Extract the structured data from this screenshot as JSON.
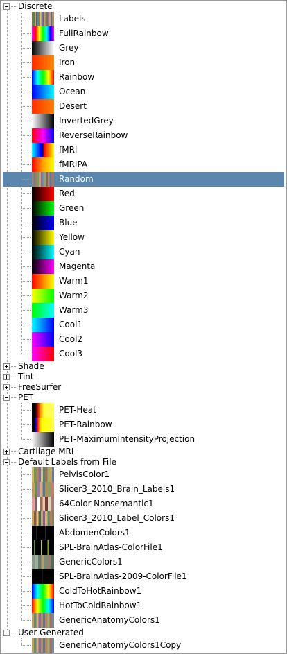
{
  "colors": {
    "selection": "#5b86ae",
    "selected_text": "#ffffff",
    "tree_lines": "#9a9a9a"
  },
  "tree": {
    "groups": [
      {
        "label": "Discrete",
        "expanded": true,
        "items": [
          {
            "label": "Labels",
            "swatch": "labels-swatch"
          },
          {
            "label": "FullRainbow",
            "swatch": "fullrainbow-swatch"
          },
          {
            "label": "Grey",
            "swatch": "grey-swatch"
          },
          {
            "label": "Iron",
            "swatch": "iron-swatch"
          },
          {
            "label": "Rainbow",
            "swatch": "rainbow-swatch"
          },
          {
            "label": "Ocean",
            "swatch": "ocean-swatch"
          },
          {
            "label": "Desert",
            "swatch": "desert-swatch"
          },
          {
            "label": "InvertedGrey",
            "swatch": "invertedgrey-swatch"
          },
          {
            "label": "ReverseRainbow",
            "swatch": "reverserainbow-swatch"
          },
          {
            "label": "fMRI",
            "swatch": "fmri-swatch"
          },
          {
            "label": "fMRIPA",
            "swatch": "fmripa-swatch"
          },
          {
            "label": "Random",
            "swatch": "random-swatch",
            "selected": true
          },
          {
            "label": "Red",
            "swatch": "red-swatch"
          },
          {
            "label": "Green",
            "swatch": "green-swatch"
          },
          {
            "label": "Blue",
            "swatch": "blue-swatch"
          },
          {
            "label": "Yellow",
            "swatch": "yellow-swatch"
          },
          {
            "label": "Cyan",
            "swatch": "cyan-swatch"
          },
          {
            "label": "Magenta",
            "swatch": "magenta-swatch"
          },
          {
            "label": "Warm1",
            "swatch": "warm1-swatch"
          },
          {
            "label": "Warm2",
            "swatch": "warm2-swatch"
          },
          {
            "label": "Warm3",
            "swatch": "warm3-swatch"
          },
          {
            "label": "Cool1",
            "swatch": "cool1-swatch"
          },
          {
            "label": "Cool2",
            "swatch": "cool2-swatch"
          },
          {
            "label": "Cool3",
            "swatch": "cool3-swatch"
          }
        ]
      },
      {
        "label": "Shade",
        "expanded": false,
        "items": []
      },
      {
        "label": "Tint",
        "expanded": false,
        "items": []
      },
      {
        "label": "FreeSurfer",
        "expanded": false,
        "items": []
      },
      {
        "label": "PET",
        "expanded": true,
        "items": [
          {
            "label": "PET-Heat",
            "swatch": "pet-heat-swatch"
          },
          {
            "label": "PET-Rainbow",
            "swatch": "pet-rainbow-swatch"
          },
          {
            "label": "PET-MaximumIntensityProjection",
            "swatch": "pet-mip-swatch"
          }
        ]
      },
      {
        "label": "Cartilage MRI",
        "expanded": false,
        "items": []
      },
      {
        "label": "Default Labels from File",
        "expanded": true,
        "items": [
          {
            "label": "PelvisColor1",
            "swatch": "pelvis-swatch"
          },
          {
            "label": "Slicer3_2010_Brain_Labels1",
            "swatch": "brain-labels-swatch"
          },
          {
            "label": "64Color-Nonsemantic1",
            "swatch": "nonsemantic-swatch"
          },
          {
            "label": "Slicer3_2010_Label_Colors1",
            "swatch": "label-colors-swatch"
          },
          {
            "label": "AbdomenColors1",
            "swatch": "abdomen-swatch"
          },
          {
            "label": "SPL-BrainAtlas-ColorFile1",
            "swatch": "spl-atlas-swatch"
          },
          {
            "label": "GenericColors1",
            "swatch": "generic-swatch"
          },
          {
            "label": "SPL-BrainAtlas-2009-ColorFile1",
            "swatch": "spl-atlas-2009-swatch"
          },
          {
            "label": "ColdToHotRainbow1",
            "swatch": "coldtohot-swatch"
          },
          {
            "label": "HotToColdRainbow1",
            "swatch": "hottocold-swatch"
          },
          {
            "label": "GenericAnatomyColors1",
            "swatch": "genericanatomy-swatch"
          }
        ]
      },
      {
        "label": "User Generated",
        "expanded": true,
        "items": [
          {
            "label": "GenericAnatomyColors1Copy",
            "swatch": "genericanatomy-copy-swatch"
          }
        ]
      }
    ]
  }
}
